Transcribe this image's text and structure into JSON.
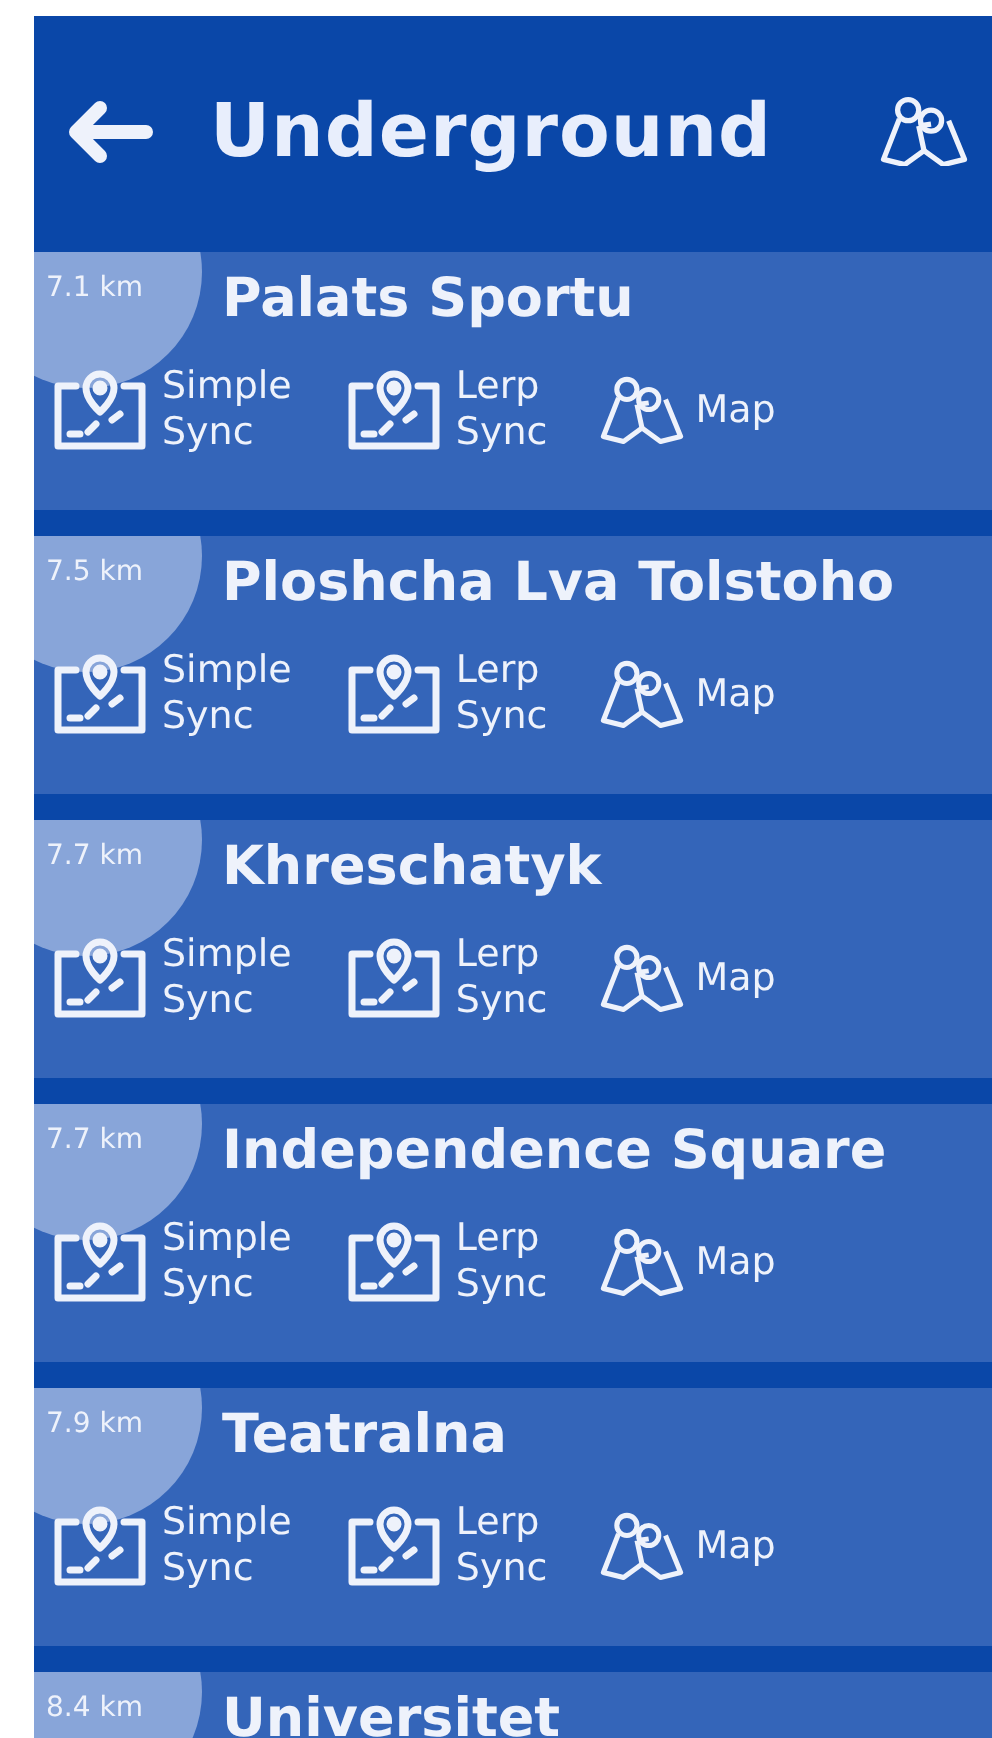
{
  "header": {
    "title": "Underground"
  },
  "stations": [
    {
      "distance": "7.1 km",
      "name": "Palats Sportu",
      "actions": [
        {
          "kind": "simple",
          "label": [
            "Simple",
            "Sync"
          ]
        },
        {
          "kind": "lerp",
          "label": [
            "Lerp",
            "Sync"
          ]
        },
        {
          "kind": "map",
          "label": [
            "Map"
          ]
        }
      ]
    },
    {
      "distance": "7.5 km",
      "name": "Ploshcha Lva Tolstoho",
      "actions": [
        {
          "kind": "simple",
          "label": [
            "Simple",
            "Sync"
          ]
        },
        {
          "kind": "lerp",
          "label": [
            "Lerp",
            "Sync"
          ]
        },
        {
          "kind": "map",
          "label": [
            "Map"
          ]
        }
      ]
    },
    {
      "distance": "7.7 km",
      "name": "Khreschatyk",
      "actions": [
        {
          "kind": "simple",
          "label": [
            "Simple",
            "Sync"
          ]
        },
        {
          "kind": "lerp",
          "label": [
            "Lerp",
            "Sync"
          ]
        },
        {
          "kind": "map",
          "label": [
            "Map"
          ]
        }
      ]
    },
    {
      "distance": "7.7 km",
      "name": "Independence Square",
      "actions": [
        {
          "kind": "simple",
          "label": [
            "Simple",
            "Sync"
          ]
        },
        {
          "kind": "lerp",
          "label": [
            "Lerp",
            "Sync"
          ]
        },
        {
          "kind": "map",
          "label": [
            "Map"
          ]
        }
      ]
    },
    {
      "distance": "7.9 km",
      "name": "Teatralna",
      "actions": [
        {
          "kind": "simple",
          "label": [
            "Simple",
            "Sync"
          ]
        },
        {
          "kind": "lerp",
          "label": [
            "Lerp",
            "Sync"
          ]
        },
        {
          "kind": "map",
          "label": [
            "Map"
          ]
        }
      ]
    },
    {
      "distance": "8.4 km",
      "name": "Universitet"
    }
  ]
}
